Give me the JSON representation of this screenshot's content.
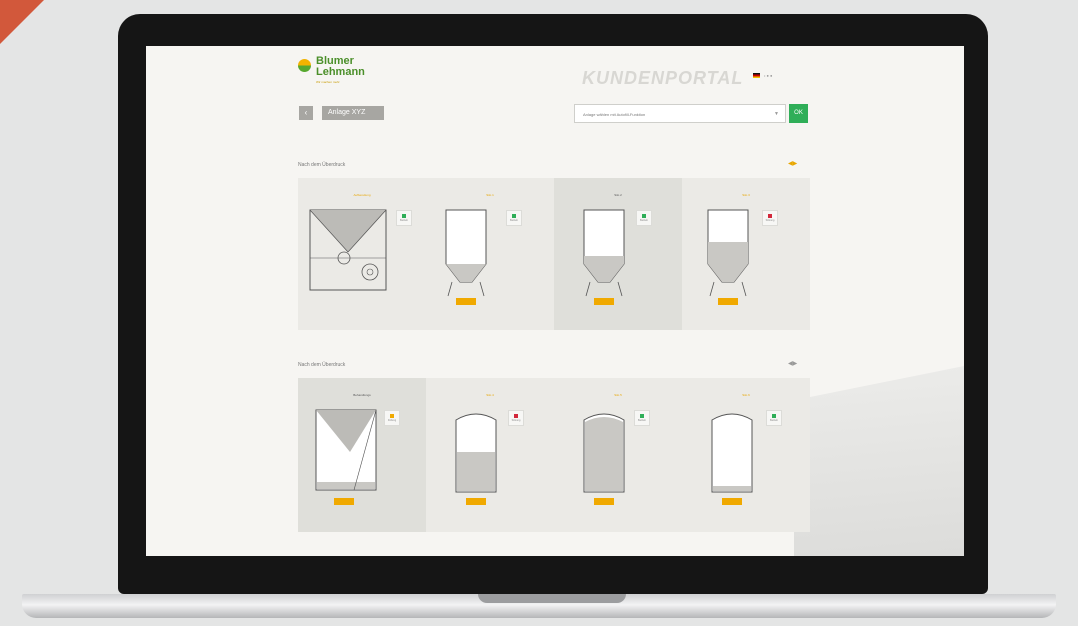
{
  "header": {
    "logo_line1": "Blumer",
    "logo_line2": "Lehmann",
    "logo_sub": "Wir machen mehr",
    "portal_title": "KUNDENPORTAL"
  },
  "toolbar": {
    "back_label": "‹",
    "plant_label": "Anlage XYZ",
    "plant_sub": "",
    "select_value": "Anlage wählen mit Autofill-Funktion",
    "go_label": "OK"
  },
  "sections": [
    {
      "title": "Nach dem Überdruck"
    },
    {
      "title": "Nach dem Überdruck"
    }
  ],
  "colors": {
    "accent": "#f0a900",
    "brand_green": "#4b8f2a",
    "ok": "#2fae58",
    "alarm": "#d2283b"
  },
  "units_row1": [
    {
      "name": "Aufbereitung",
      "status": "ok",
      "status_label": "Betrieb",
      "qty": "",
      "level": 0
    },
    {
      "name": "Silo 1",
      "status": "ok",
      "status_label": "Betrieb",
      "qty": "",
      "level": 0
    },
    {
      "name": "Silo 2",
      "status": "ok",
      "status_label": "Betrieb",
      "qty": "",
      "level": 0.2
    },
    {
      "name": "Silo 3",
      "status": "alarm",
      "status_label": "Störung",
      "qty": "",
      "level": 0.55
    }
  ],
  "units_row2": [
    {
      "name": "Behandlungs",
      "status": "warn",
      "status_label": "Füllung",
      "qty": "",
      "level": 0.05
    },
    {
      "name": "Silo 4",
      "status": "alarm",
      "status_label": "Störung",
      "qty": "",
      "level": 0.5
    },
    {
      "name": "Silo 5",
      "status": "ok",
      "status_label": "Betrieb",
      "qty": "",
      "level": 0.85
    },
    {
      "name": "Silo 6",
      "status": "ok",
      "status_label": "Betrieb",
      "qty": "",
      "level": 0.05
    }
  ]
}
